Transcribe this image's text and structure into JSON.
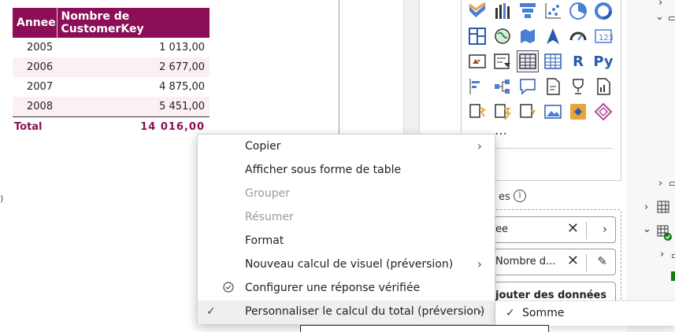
{
  "table": {
    "headers": [
      "Annee",
      "Nombre de CustomerKey"
    ],
    "rows": [
      {
        "year": "2005",
        "value": "1 013,00"
      },
      {
        "year": "2006",
        "value": "2 677,00"
      },
      {
        "year": "2007",
        "value": "4 875,00"
      },
      {
        "year": "2008",
        "value": "5 451,00"
      }
    ],
    "total_label": "Total",
    "total_value": "14 016,00"
  },
  "viz_pane": {
    "icons": [
      "ribbon-chart-icon",
      "waterfall-chart-icon",
      "funnel-chart-icon",
      "scatter-chart-icon",
      "pie-chart-icon",
      "donut-chart-icon",
      "treemap-icon",
      "map-icon",
      "filled-map-icon",
      "azure-map-icon",
      "gauge-icon",
      "card-icon",
      "kpi-icon",
      "slicer-icon",
      "table-icon",
      "matrix-icon",
      "r-visual-icon",
      "python-visual-icon",
      "key-influencers-icon",
      "decomposition-tree-icon",
      "qa-icon",
      "smart-narrative-icon",
      "metrics-icon",
      "paginated-report-icon",
      "power-automate-icon",
      "power-apps-icon",
      "custom-visual-icon",
      "image-icon",
      "arcgis-icon",
      "diamond-visual-icon"
    ],
    "more": "…",
    "values_label": "es",
    "info": "i"
  },
  "wells": {
    "field1": "ee",
    "field2": "Nombre d...",
    "add": "jouter des données"
  },
  "context_menu": {
    "items": [
      {
        "label": "Copier",
        "submenu": true,
        "disabled": false
      },
      {
        "label": "Afficher sous forme de table",
        "submenu": false,
        "disabled": false
      },
      {
        "label": "Grouper",
        "submenu": false,
        "disabled": true
      },
      {
        "label": "Résumer",
        "submenu": false,
        "disabled": true
      },
      {
        "label": "Format",
        "submenu": false,
        "disabled": false
      },
      {
        "label": "Nouveau calcul de visuel (préversion)",
        "submenu": true,
        "disabled": false
      },
      {
        "label": "Configurer une réponse vérifiée",
        "submenu": false,
        "disabled": false
      },
      {
        "label": "Personnaliser le calcul du total (préversion)",
        "submenu": true,
        "disabled": false
      }
    ]
  },
  "submenu": {
    "items": [
      {
        "label": "Somme",
        "checked": true
      }
    ]
  },
  "colors": {
    "header_bg": "#8b0e57",
    "total_text": "#8b0e57",
    "accent_green": "#107c10"
  }
}
